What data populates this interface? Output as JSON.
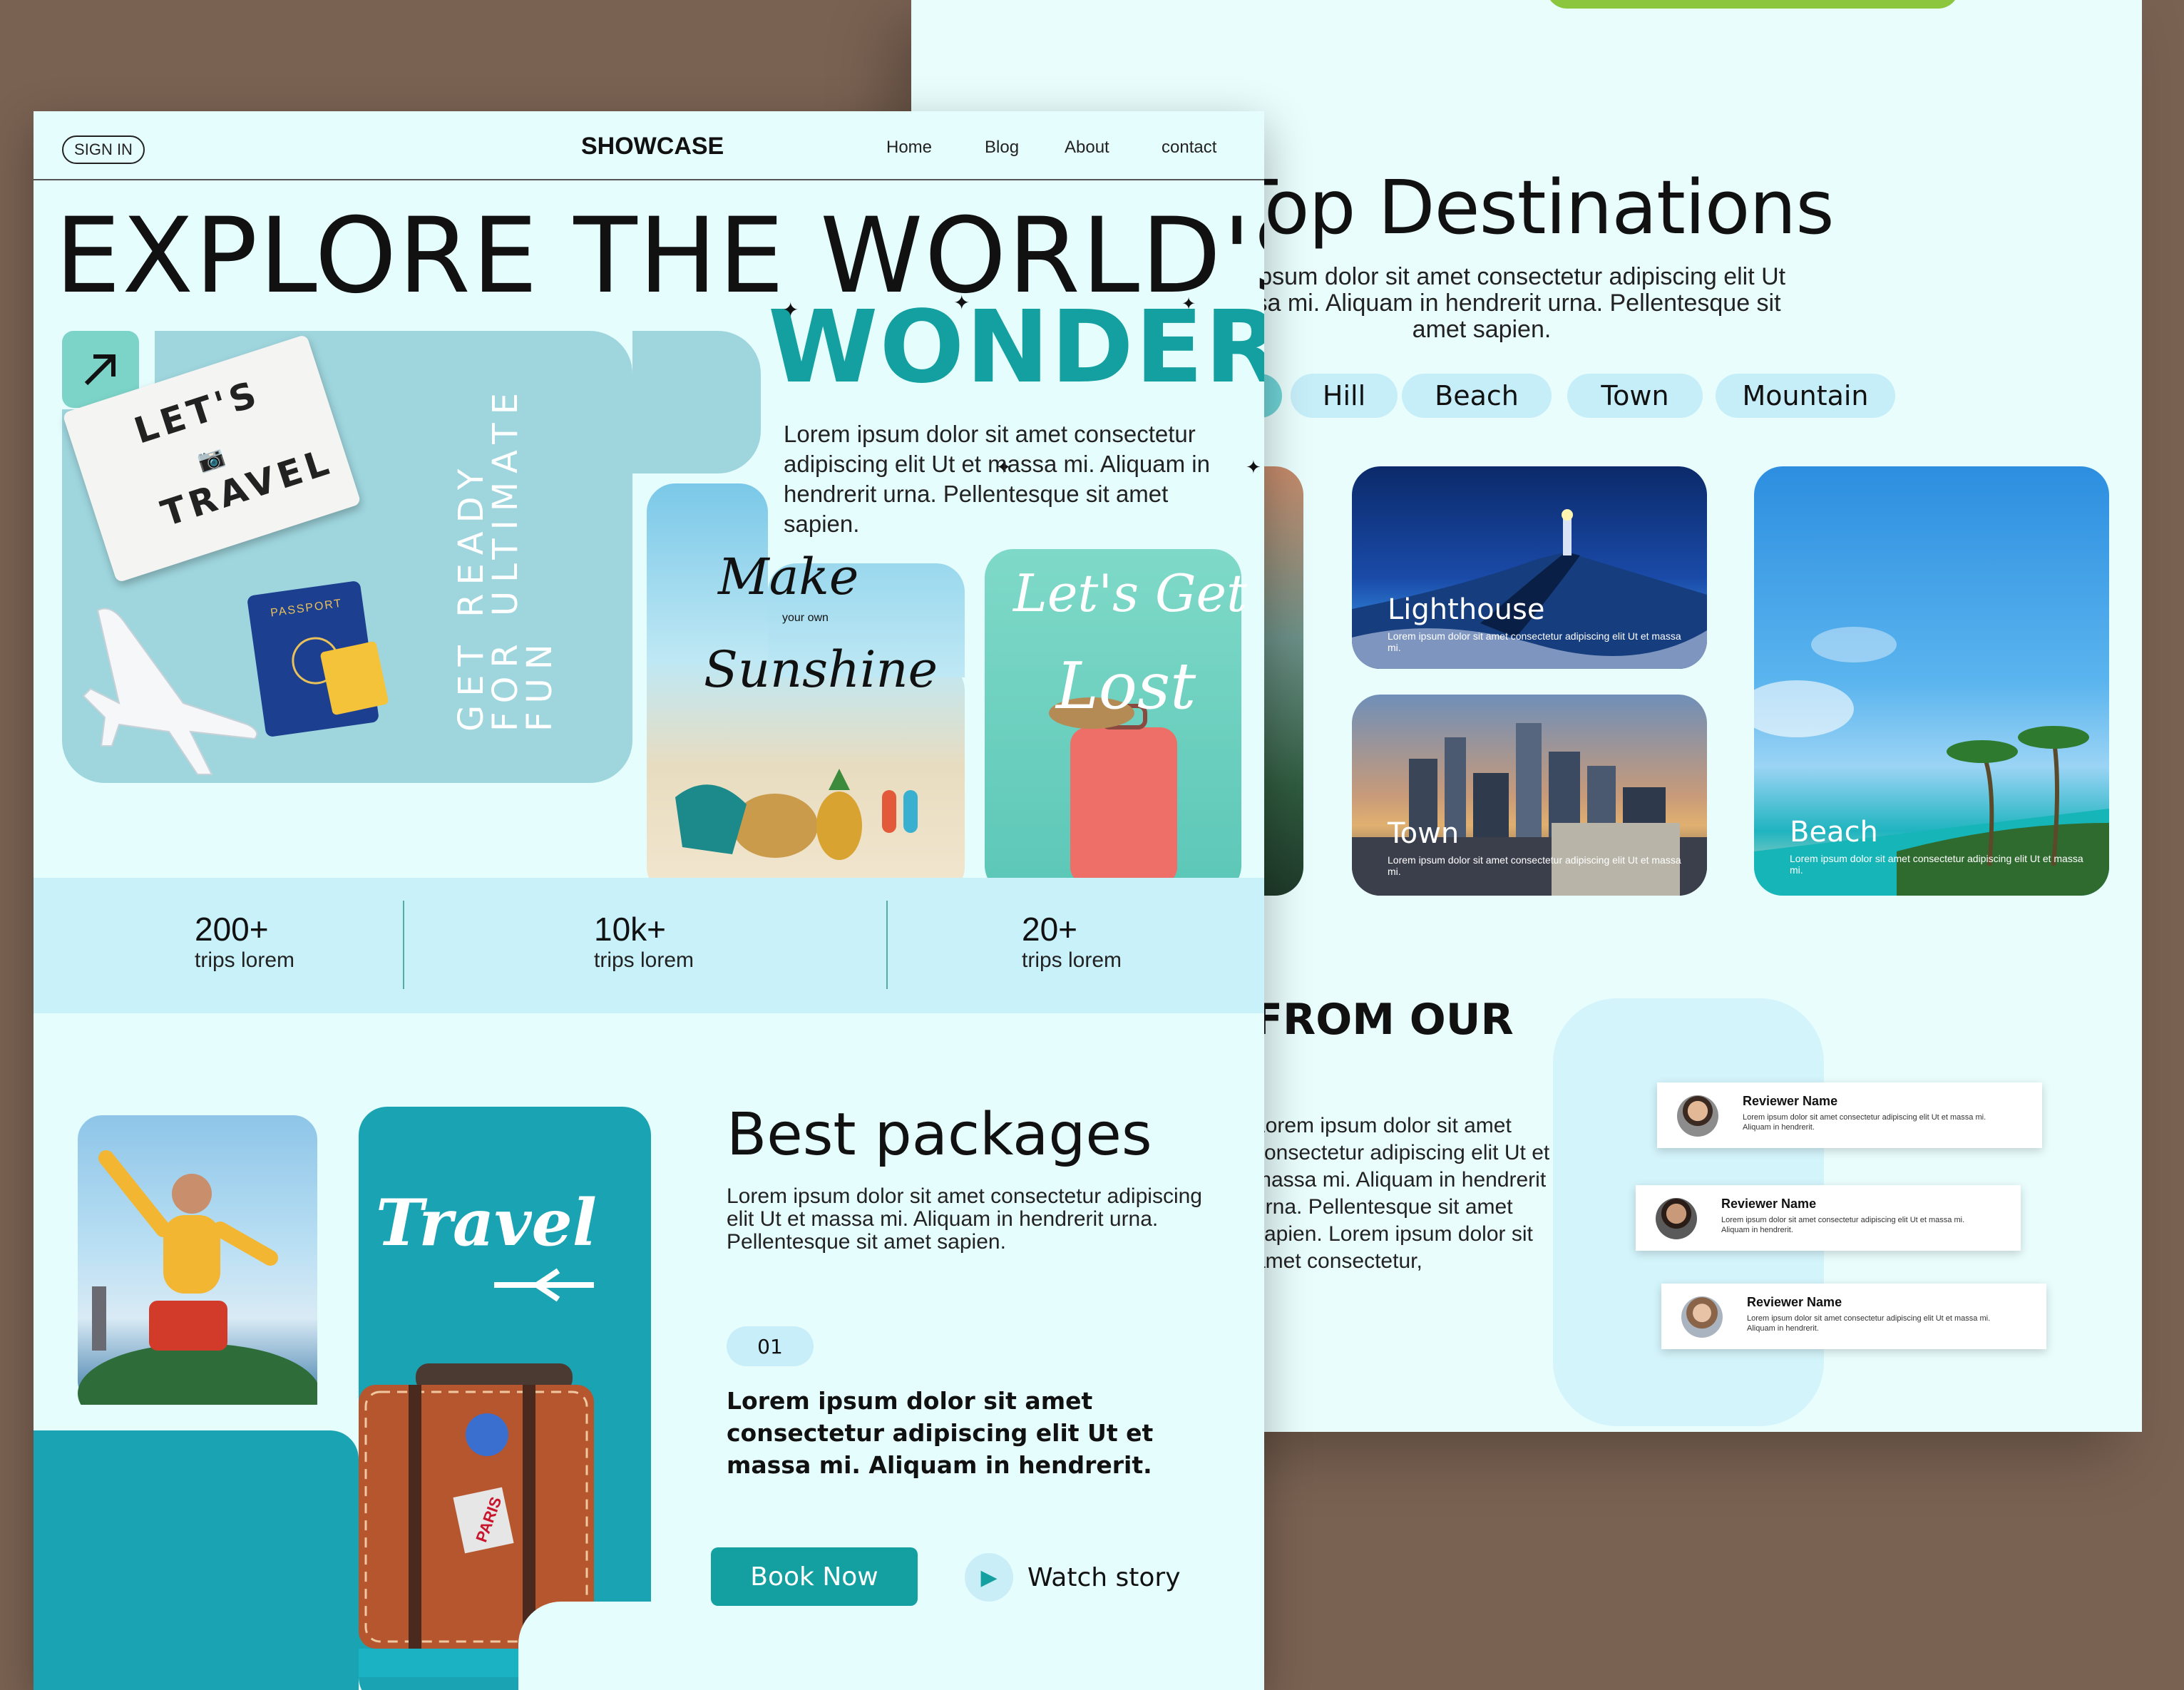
{
  "back_page": {
    "destinations_title": "Top Destinations",
    "destinations_desc": "Lorem ipsum dolor sit amet consectetur adipiscing elit Ut et massa mi. Aliquam in hendrerit urna. Pellentesque sit amet sapien.",
    "filters": [
      "Hill",
      "Beach",
      "Town",
      "Mountain"
    ],
    "cards": [
      {
        "label": "Lighthouse",
        "sub": "Lorem ipsum dolor sit amet consectetur adipiscing elit Ut et massa mi."
      },
      {
        "label": "Town",
        "sub": "Lorem ipsum dolor sit amet consectetur adipiscing elit Ut et massa mi."
      },
      {
        "label": "Beach",
        "sub": "Lorem ipsum dolor sit amet consectetur adipiscing elit Ut et massa mi."
      }
    ],
    "testimonials_heading": "FROM OUR",
    "testimonials_text": "Lorem ipsum dolor sit amet consectetur adipiscing elit Ut et massa mi. Aliquam in hendrerit urna. Pellentesque sit amet sapien. Lorem ipsum dolor sit amet consectetur,",
    "reviews": [
      {
        "name": "Reviewer Name",
        "text": "Lorem ipsum dolor sit amet consectetur adipiscing elit Ut et massa mi. Aliquam in hendrerit."
      },
      {
        "name": "Reviewer Name",
        "text": "Lorem ipsum dolor sit amet consectetur adipiscing elit Ut et massa mi. Aliquam in hendrerit."
      },
      {
        "name": "Reviewer Name",
        "text": "Lorem ipsum dolor sit amet consectetur adipiscing elit Ut et massa mi. Aliquam in hendrerit."
      }
    ]
  },
  "nav": {
    "sign_in": "SIGN IN",
    "brand": "SHOWCASE",
    "links": [
      "Home",
      "Blog",
      "About",
      "contact"
    ]
  },
  "hero": {
    "line1": "EXPLORE THE WORLD'S",
    "line2": "WONDER",
    "desc": "Lorem ipsum dolor sit amet consectetur adipiscing elit Ut et massa mi. Aliquam in hendrerit urna. Pellentesque sit amet sapien.",
    "vertical_text": [
      "GET READY",
      "FOR ULTIMATE",
      "FUN"
    ],
    "lightbox_text": [
      "LET'S",
      "TRAVEL"
    ],
    "passport": "PASSPORT",
    "sunshine_text": [
      "Make",
      "your own",
      "Sunshine"
    ],
    "lost_text": [
      "Let's Get",
      "Lost"
    ]
  },
  "stats": [
    {
      "num": "200+",
      "label": "trips lorem"
    },
    {
      "num": "10k+",
      "label": "trips lorem"
    },
    {
      "num": "20+",
      "label": "trips lorem"
    }
  ],
  "packages": {
    "title": "Best packages",
    "desc": "Lorem ipsum dolor sit amet consectetur adipiscing elit Ut et massa mi. Aliquam in hendrerit urna. Pellentesque sit amet sapien.",
    "number": "01",
    "bold_text": "Lorem ipsum dolor sit amet consectetur adipiscing elit Ut et massa mi. Aliquam in hendrerit.",
    "travel_word": "Travel",
    "sticker": "PARIS",
    "book_now": "Book Now",
    "watch_story": "Watch story"
  },
  "colors": {
    "accent": "#14a0a0",
    "page_bg": "#e6fdfd",
    "stats_bg": "#c9f1fa",
    "outer_bg": "#7a6252",
    "green": "#8cc63f"
  }
}
